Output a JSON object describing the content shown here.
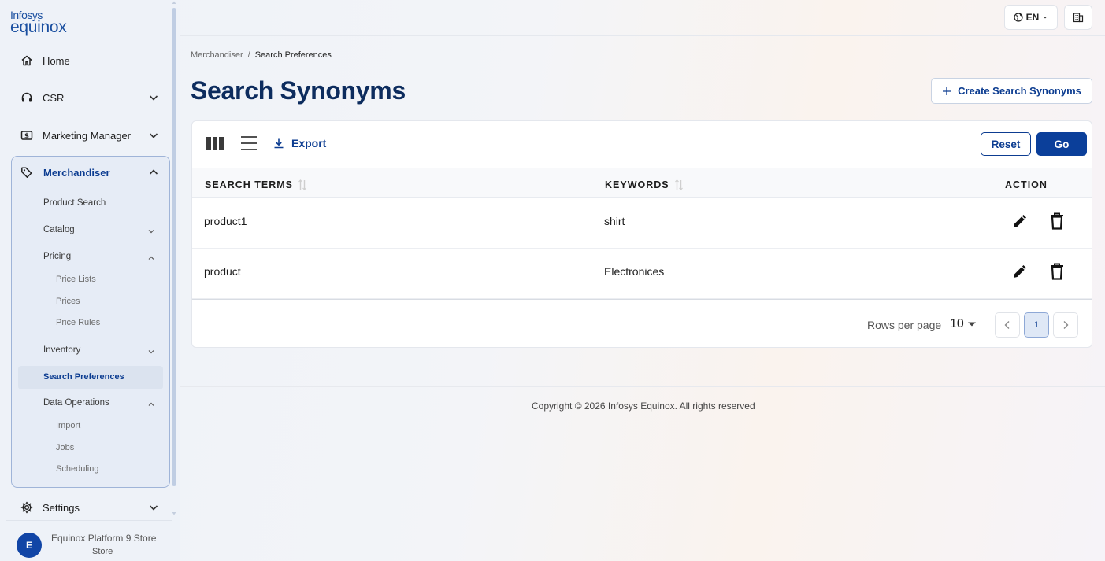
{
  "brand": {
    "line1": "Infosys",
    "line2": "equinox"
  },
  "sidebar": {
    "items": [
      {
        "label": "Home",
        "icon": "home-icon"
      },
      {
        "label": "CSR",
        "icon": "headset-icon"
      },
      {
        "label": "Marketing Manager",
        "icon": "dollar-icon"
      }
    ],
    "merchandiser": {
      "label": "Merchandiser",
      "icon": "tag-icon",
      "children": {
        "product_search": "Product Search",
        "catalog": "Catalog",
        "pricing": "Pricing",
        "price_lists": "Price Lists",
        "prices": "Prices",
        "price_rules": "Price Rules",
        "inventory": "Inventory",
        "search_preferences": "Search Preferences",
        "data_operations": "Data Operations",
        "import": "Import",
        "jobs": "Jobs",
        "scheduling": "Scheduling"
      }
    },
    "settings": "Settings",
    "store": {
      "avatar": "E",
      "name": "Equinox Platform 9 Store",
      "type": "Store"
    }
  },
  "header": {
    "language": "EN"
  },
  "breadcrumb": {
    "parent": "Merchandiser",
    "separator": "/",
    "current": "Search Preferences"
  },
  "page": {
    "title": "Search Synonyms",
    "create_label": "Create Search Synonyms"
  },
  "toolbar": {
    "export_label": "Export",
    "reset_label": "Reset",
    "go_label": "Go"
  },
  "table": {
    "columns": {
      "terms": "SEARCH TERMS",
      "keywords": "KEYWORDS",
      "action": "ACTION"
    },
    "rows": [
      {
        "term": "product1",
        "keywords": "shirt"
      },
      {
        "term": "product",
        "keywords": "Electronices"
      }
    ]
  },
  "pagination": {
    "rows_per_page_label": "Rows per page",
    "rows_per_page": "10",
    "current_page": "1"
  },
  "footer": {
    "copyright": "Copyright © 2026 Infosys Equinox. All rights reserved"
  },
  "colors": {
    "primary": "#0b3f9a",
    "title": "#0d2c5e",
    "sidebar_bg": "#eef2f8"
  }
}
